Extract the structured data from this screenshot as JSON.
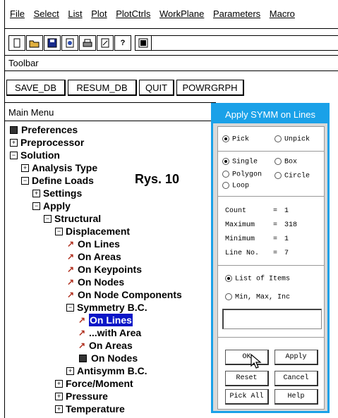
{
  "menubar": {
    "items": [
      "File",
      "Select",
      "List",
      "Plot",
      "PlotCtrls",
      "WorkPlane",
      "Parameters",
      "Macro"
    ]
  },
  "icons": [
    "new-file-icon",
    "open-folder-icon",
    "save-icon",
    "report-icon",
    "print-icon",
    "help-file-icon",
    "help-icon",
    "grid-icon"
  ],
  "toolbar": {
    "label": "Toolbar",
    "buttons": [
      "SAVE_DB",
      "RESUM_DB",
      "QUIT",
      "POWRGRPH"
    ]
  },
  "main_menu": {
    "label": "Main Menu",
    "tree": [
      {
        "text": "Preferences",
        "kind": "square"
      },
      {
        "text": "Preprocessor",
        "kind": "plus"
      },
      {
        "text": "Solution",
        "kind": "minus"
      },
      {
        "text": "Analysis Type",
        "kind": "plus"
      },
      {
        "text": "Define Loads",
        "kind": "minus"
      },
      {
        "text": "Settings",
        "kind": "plus"
      },
      {
        "text": "Apply",
        "kind": "minus"
      },
      {
        "text": "Structural",
        "kind": "minus"
      },
      {
        "text": "Displacement",
        "kind": "minus"
      },
      {
        "text": "On Lines",
        "kind": "arrow"
      },
      {
        "text": "On Areas",
        "kind": "arrow"
      },
      {
        "text": "On Keypoints",
        "kind": "arrow"
      },
      {
        "text": "On Nodes",
        "kind": "arrow"
      },
      {
        "text": "On Node Components",
        "kind": "arrow"
      },
      {
        "text": "Symmetry B.C.",
        "kind": "minus"
      },
      {
        "text": "On Lines",
        "kind": "arrow"
      },
      {
        "text": "...with Area",
        "kind": "arrow"
      },
      {
        "text": "On Areas",
        "kind": "arrow"
      },
      {
        "text": "On Nodes",
        "kind": "square"
      },
      {
        "text": "Antisymm B.C.",
        "kind": "plus"
      },
      {
        "text": "Force/Moment",
        "kind": "plus"
      },
      {
        "text": "Pressure",
        "kind": "plus"
      },
      {
        "text": "Temperature",
        "kind": "plus"
      }
    ]
  },
  "annotation": "Rys. 10",
  "dialog": {
    "title": "Apply SYMM on Lines",
    "pick": "Pick",
    "unpick": "Unpick",
    "single": "Single",
    "box": "Box",
    "polygon": "Polygon",
    "circle": "Circle",
    "loop": "Loop",
    "stats": [
      {
        "label": "Count",
        "value": "1"
      },
      {
        "label": "Maximum",
        "value": "318"
      },
      {
        "label": "Minimum",
        "value": "1"
      },
      {
        "label": "Line No.",
        "value": "7"
      }
    ],
    "list_of_items": "List of Items",
    "min_max_inc": "Min, Max, Inc",
    "input_value": "",
    "buttons": {
      "ok": "OK",
      "apply": "Apply",
      "reset": "Reset",
      "cancel": "Cancel",
      "pick_all": "Pick All",
      "help": "Help"
    }
  }
}
